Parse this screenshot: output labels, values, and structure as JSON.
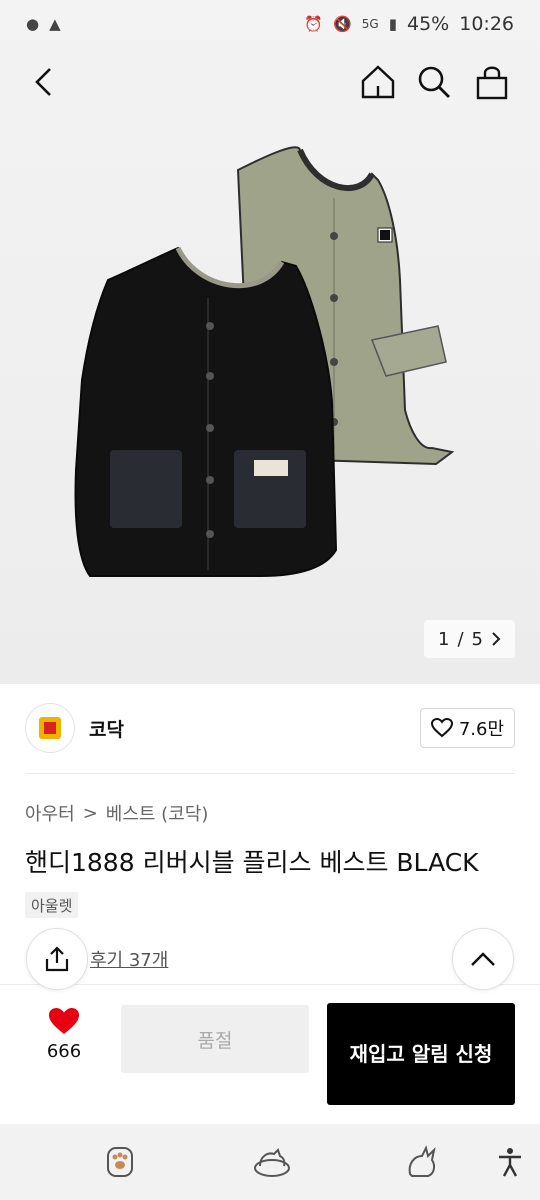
{
  "status_bar": {
    "network": "5G",
    "battery": "45%",
    "time": "10:26"
  },
  "nav": {
    "back_icon": "chevron-left-icon",
    "home_icon": "home-icon",
    "search_icon": "search-icon",
    "bag_icon": "bag-icon"
  },
  "gallery": {
    "pager_current": "1",
    "pager_sep": "/",
    "pager_total": "5"
  },
  "brand": {
    "name": "코닥",
    "likes": "7.6만",
    "logo_colors": {
      "outer": "#f2b200",
      "inner": "#d8241c"
    }
  },
  "breadcrumb": {
    "category": "아우터",
    "separator": ">",
    "subcategory": "베스트 (코닥)"
  },
  "product": {
    "title": "핸디1888 리버시블 플리스 베스트 BLACK",
    "tag": "아울렛",
    "reviews": "후기 37개"
  },
  "actions": {
    "wish_count": "666",
    "soldout_label": "품절",
    "restock_label": "재입고 알림 신청",
    "accent": "#e60012"
  },
  "bottom_nav": {
    "icons": [
      "paw-icon",
      "cat-bed-icon",
      "cat-icon",
      "accessibility-icon"
    ]
  }
}
